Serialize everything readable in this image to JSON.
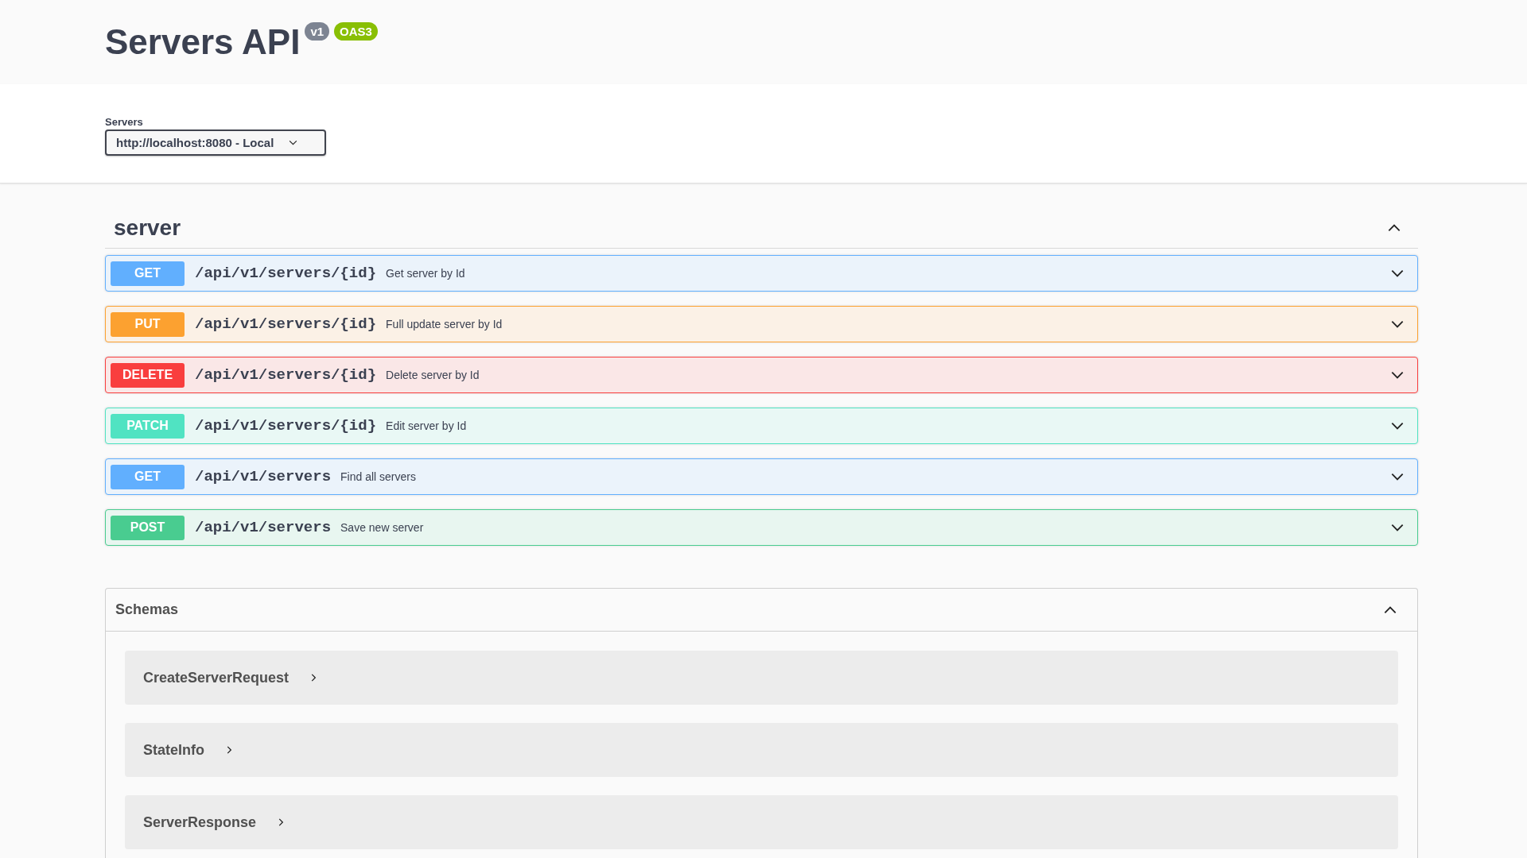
{
  "header": {
    "title": "Servers API",
    "version_badge": "v1",
    "spec_badge": "OAS3"
  },
  "servers": {
    "label": "Servers",
    "value": "http://localhost:8080 - Local"
  },
  "tag": {
    "name": "server",
    "expanded": true
  },
  "operations": [
    {
      "kind": "get",
      "method": "GET",
      "path": "/api/v1/servers/{id}",
      "summary": "Get server by Id",
      "expanded": false
    },
    {
      "kind": "put",
      "method": "PUT",
      "path": "/api/v1/servers/{id}",
      "summary": "Full update server by Id",
      "expanded": false
    },
    {
      "kind": "delete",
      "method": "DELETE",
      "path": "/api/v1/servers/{id}",
      "summary": "Delete server by Id",
      "expanded": false
    },
    {
      "kind": "patch",
      "method": "PATCH",
      "path": "/api/v1/servers/{id}",
      "summary": "Edit server by Id",
      "expanded": false
    },
    {
      "kind": "get",
      "method": "GET",
      "path": "/api/v1/servers",
      "summary": "Find all servers",
      "expanded": false
    },
    {
      "kind": "post",
      "method": "POST",
      "path": "/api/v1/servers",
      "summary": "Save new server",
      "expanded": false
    }
  ],
  "schemas": {
    "title": "Schemas",
    "expanded": true,
    "items": [
      {
        "name": "CreateServerRequest",
        "expanded": false
      },
      {
        "name": "StateInfo",
        "expanded": false
      },
      {
        "name": "ServerResponse",
        "expanded": false
      }
    ]
  }
}
